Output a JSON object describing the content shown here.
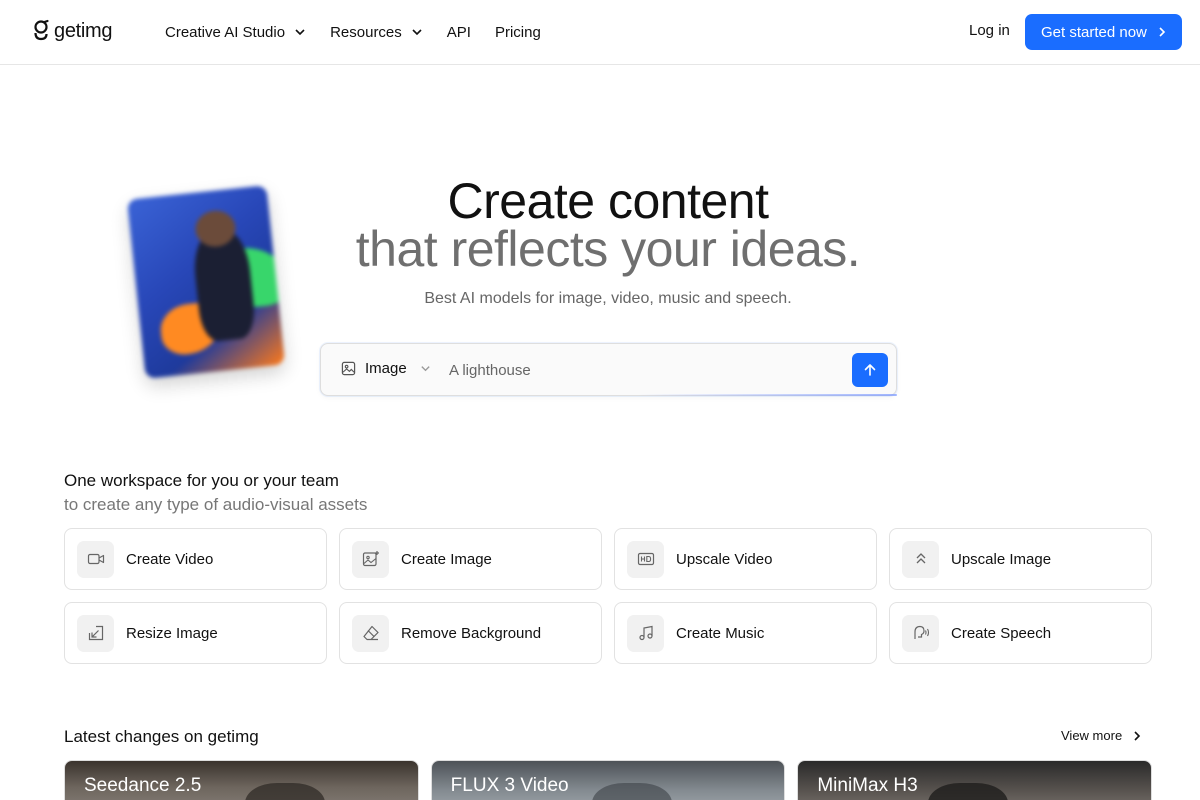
{
  "brand": {
    "name": "getimg",
    "accent": "#1a6dff"
  },
  "nav": {
    "items": [
      {
        "label": "Creative AI Studio",
        "dropdown": true
      },
      {
        "label": "Resources",
        "dropdown": true
      },
      {
        "label": "API",
        "dropdown": false
      },
      {
        "label": "Pricing",
        "dropdown": false
      }
    ],
    "login": "Log in",
    "cta": "Get started now"
  },
  "hero": {
    "title_line1": "Create content",
    "title_line2": "that reflects your ideas.",
    "subtitle": "Best AI models for image, video, music and speech.",
    "prompt": {
      "type_label": "Image",
      "placeholder": "A lighthouse"
    }
  },
  "workspace": {
    "title": "One workspace for you or your team",
    "subtitle": "to create any type of audio-visual assets",
    "tools": [
      {
        "label": "Create Video",
        "icon": "video-camera-icon"
      },
      {
        "label": "Create Image",
        "icon": "image-sparkle-icon"
      },
      {
        "label": "Upscale Video",
        "icon": "hd-icon"
      },
      {
        "label": "Upscale Image",
        "icon": "chevrons-up-icon"
      },
      {
        "label": "Resize Image",
        "icon": "resize-icon"
      },
      {
        "label": "Remove Background",
        "icon": "eraser-icon"
      },
      {
        "label": "Create Music",
        "icon": "music-note-icon"
      },
      {
        "label": "Create Speech",
        "icon": "speech-icon"
      }
    ]
  },
  "latest": {
    "title": "Latest changes on getimg",
    "view_more": "View more",
    "cards": [
      {
        "title": "Seedance 2.5"
      },
      {
        "title": "FLUX 3 Video"
      },
      {
        "title": "MiniMax H3"
      }
    ]
  }
}
